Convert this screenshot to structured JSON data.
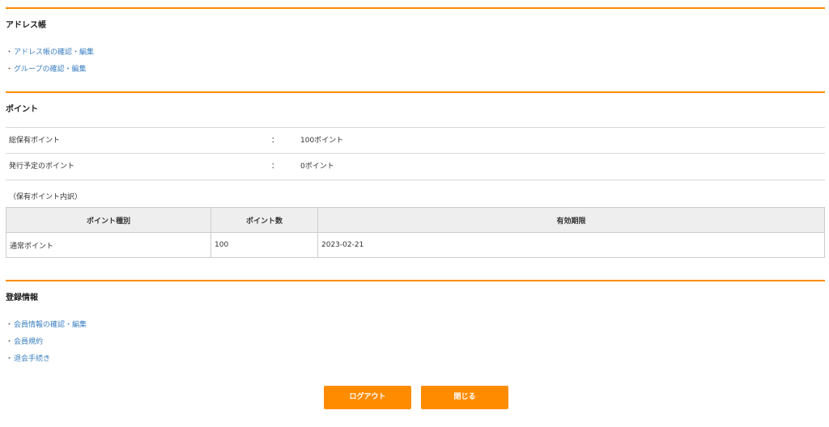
{
  "theme": {
    "accent": "#ff8c00",
    "link": "#3a7fc1"
  },
  "address_book": {
    "title": "アドレス帳",
    "links": [
      {
        "bullet": "・",
        "label": "アドレス帳の確認・編集"
      },
      {
        "bullet": "・",
        "label": "グループの確認・編集"
      }
    ]
  },
  "points": {
    "title": "ポイント",
    "rows": [
      {
        "label": "総保有ポイント",
        "sep": "：",
        "value": "100ポイント"
      },
      {
        "label": "発行予定のポイント",
        "sep": "：",
        "value": "0ポイント"
      }
    ],
    "breakdown_note": "（保有ポイント内訳）",
    "table": {
      "headers": [
        "ポイント種別",
        "ポイント数",
        "有効期限"
      ],
      "rows": [
        [
          "通常ポイント",
          "100",
          "2023-02-21"
        ]
      ]
    }
  },
  "registration": {
    "title": "登録情報",
    "links": [
      {
        "bullet": "・",
        "label": "会員情報の確認・編集"
      },
      {
        "bullet": "・",
        "label": "会員規約"
      },
      {
        "bullet": "・",
        "label": "退会手続き"
      }
    ]
  },
  "actions": {
    "logout_label": "ログアウト",
    "close_label": "閉じる"
  }
}
